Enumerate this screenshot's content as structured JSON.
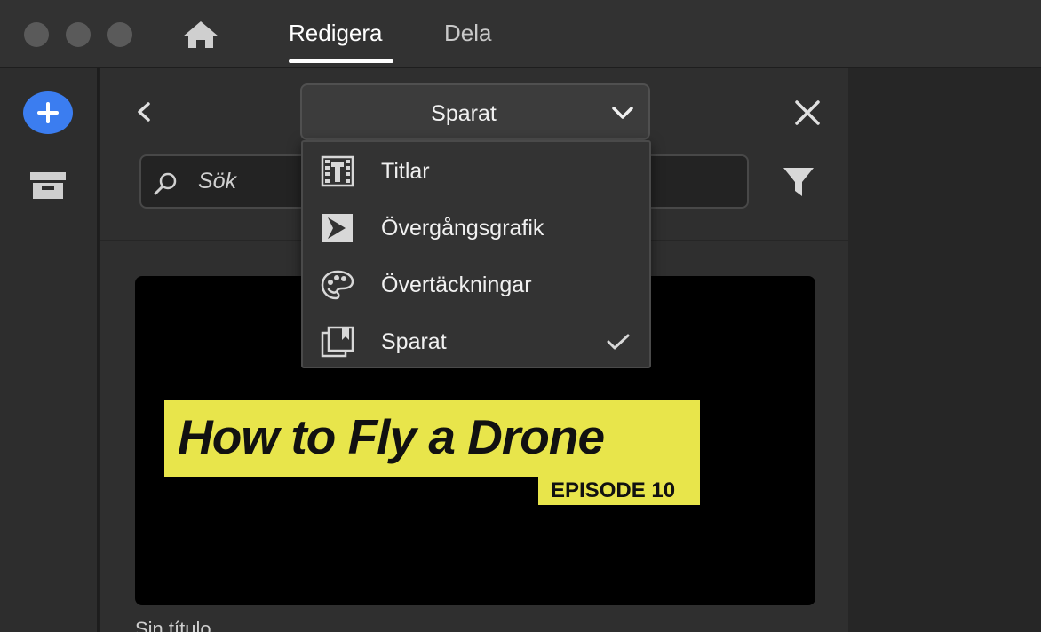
{
  "titlebar": {
    "tabs": [
      {
        "label": "Redigera",
        "active": true
      },
      {
        "label": "Dela",
        "active": false
      }
    ]
  },
  "rail": {
    "add_icon": "plus-circle-icon",
    "archive_icon": "archive-box-icon"
  },
  "panel": {
    "dropdown": {
      "selected": "Sparat"
    },
    "search": {
      "placeholder": "Sök"
    },
    "menu": {
      "items": [
        {
          "label": "Titlar",
          "icon": "titles-icon",
          "checked": false
        },
        {
          "label": "Övergångsgrafik",
          "icon": "transition-graphics-icon",
          "checked": false
        },
        {
          "label": "Övertäckningar",
          "icon": "overlays-palette-icon",
          "checked": false
        },
        {
          "label": "Sparat",
          "icon": "saved-bookmark-icon",
          "checked": true
        }
      ]
    },
    "thumbnail": {
      "title": "How to Fly a Drone",
      "episode": "EPISODE 10",
      "caption": "Sin título"
    }
  },
  "colors": {
    "accent": "#3b7df0",
    "title_highlight": "#e8e54b",
    "background": "#2f2f2f"
  }
}
